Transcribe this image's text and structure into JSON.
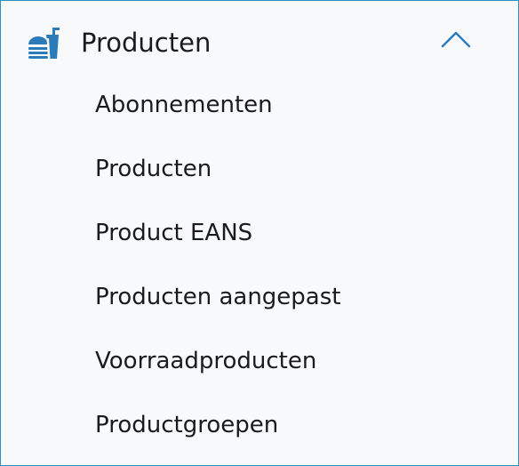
{
  "section": {
    "title": "Producten",
    "icon": "fast-food-icon",
    "expanded": true,
    "accent_color": "#2d7ab8",
    "border_color": "#2d8fc4"
  },
  "submenu": {
    "items": [
      {
        "label": "Abonnementen"
      },
      {
        "label": "Producten"
      },
      {
        "label": "Product EANS"
      },
      {
        "label": "Producten aangepast"
      },
      {
        "label": "Voorraadproducten"
      },
      {
        "label": "Productgroepen"
      }
    ]
  }
}
